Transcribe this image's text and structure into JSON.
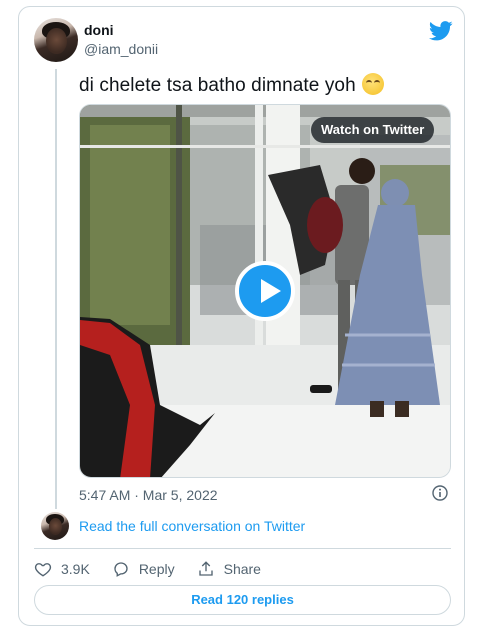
{
  "author": {
    "name": "doni",
    "handle": "@iam_donii"
  },
  "tweet": {
    "text": "di chelete tsa batho dimnate yoh",
    "emoji": "face-with-rolling-eyes-emoji",
    "timestamp": "5:47 AM · Mar 5, 2022"
  },
  "video": {
    "watch_label": "Watch on Twitter"
  },
  "conversation": {
    "link_text": "Read the full conversation on Twitter"
  },
  "actions": {
    "likes": "3.9K",
    "reply": "Reply",
    "share": "Share"
  },
  "replies_button": "Read 120 replies",
  "colors": {
    "accent": "#1d9bf0",
    "text": "#0f1419",
    "muted": "#536471",
    "border": "#cfd9de"
  }
}
